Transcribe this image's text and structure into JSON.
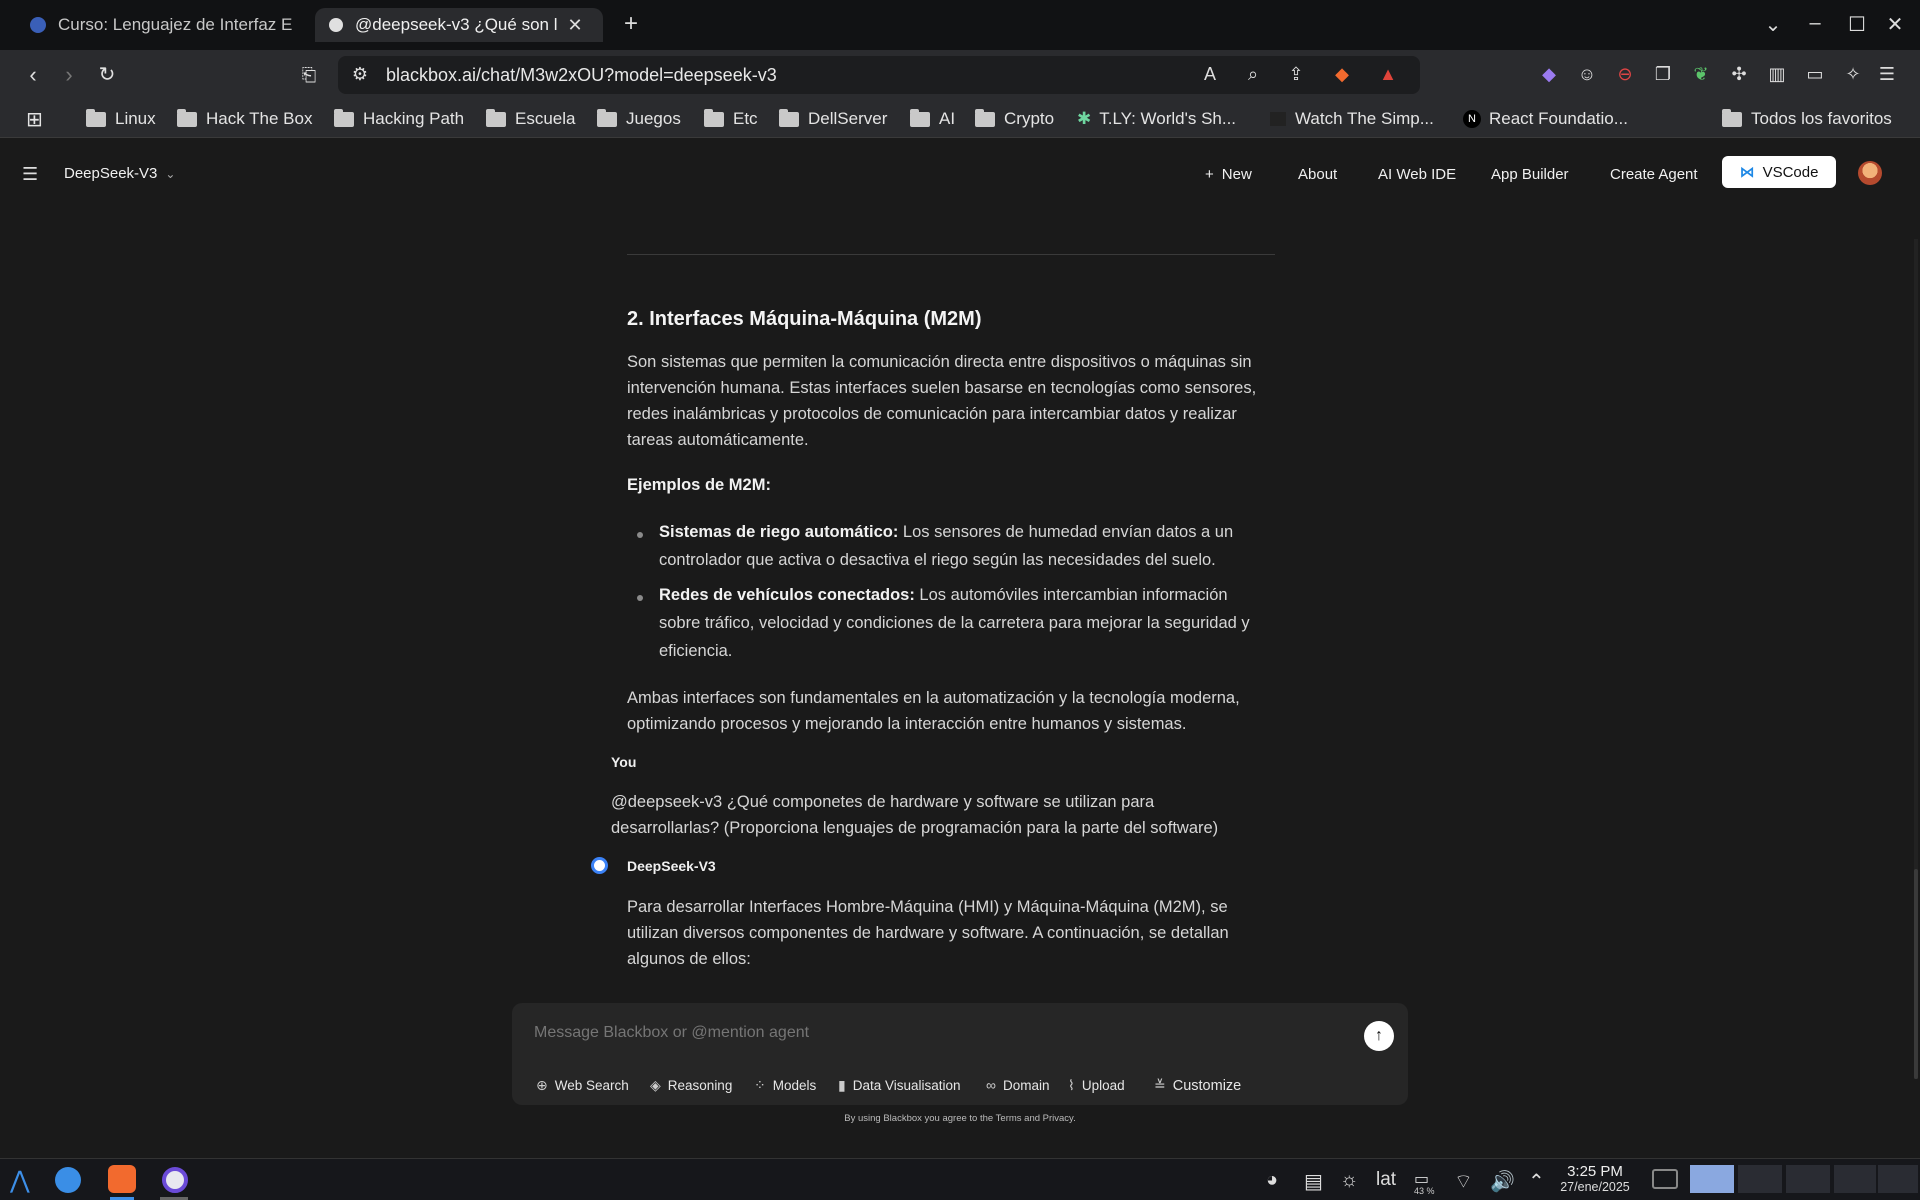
{
  "tabs": [
    {
      "title": "Curso: Lenguajez de Interfaz E"
    },
    {
      "title": "@deepseek-v3 ¿Qué son l"
    }
  ],
  "address_bar": {
    "url": "blackbox.ai/chat/M3w2xOU?model=deepseek-v3"
  },
  "bookmarks": [
    {
      "label": "Linux"
    },
    {
      "label": "Hack The Box"
    },
    {
      "label": "Hacking Path"
    },
    {
      "label": "Escuela"
    },
    {
      "label": "Juegos"
    },
    {
      "label": "Etc"
    },
    {
      "label": "DellServer"
    },
    {
      "label": "AI"
    },
    {
      "label": "Crypto"
    },
    {
      "label": "T.LY: World's Sh..."
    },
    {
      "label": "Watch The Simp..."
    },
    {
      "label": "React Foundatio..."
    },
    {
      "label": "Todos los favoritos"
    }
  ],
  "app_header": {
    "model_selector": "DeepSeek-V3",
    "new_label": "New",
    "about": "About",
    "ai_web_ide": "AI Web IDE",
    "app_builder": "App Builder",
    "create_agent": "Create Agent",
    "vscode": "VSCode"
  },
  "message": {
    "heading": "2. Interfaces Máquina-Máquina (M2M)",
    "intro_line1": "Son sistemas que permiten la comunicación directa entre dispositivos o máquinas sin",
    "intro_line2": "intervención humana. Estas interfaces suelen basarse en tecnologías como sensores,",
    "intro_line3": "redes inalámbricas y protocolos de comunicación para intercambiar datos y realizar",
    "intro_line4": "tareas automáticamente.",
    "examples_title": "Ejemplos de M2M:",
    "bullet1_bold": "Sistemas de riego automático:",
    "bullet1_line1": " Los sensores de humedad envían datos a un",
    "bullet1_line2": "controlador que activa o desactiva el riego según las necesidades del suelo.",
    "bullet2_bold": "Redes de vehículos conectados:",
    "bullet2_line1": " Los automóviles intercambian información",
    "bullet2_line2": "sobre tráfico, velocidad y condiciones de la carretera para mejorar la seguridad y",
    "bullet2_line3": "eficiencia.",
    "conclusion_line1": "Ambas interfaces son fundamentales en la automatización y la tecnología moderna,",
    "conclusion_line2": "optimizando procesos y mejorando la interacción entre humanos y sistemas."
  },
  "user_message": {
    "author": "You",
    "line1": "@deepseek-v3 ¿Qué componetes de hardware y software se utilizan para",
    "line2": "desarrollarlas? (Proporciona lenguajes de programación para la parte del software)"
  },
  "reply": {
    "author": "DeepSeek-V3",
    "line1": "Para desarrollar Interfaces Hombre-Máquina (HMI) y Máquina-Máquina (M2M), se",
    "line2": "utilizan diversos componentes de hardware y software. A continuación, se detallan",
    "line3": "algunos de ellos:"
  },
  "composer": {
    "placeholder": "Message Blackbox or @mention agent",
    "tools": [
      "Web Search",
      "Reasoning",
      "Models",
      "Data Visualisation",
      "Domain",
      "Upload",
      "Customize"
    ],
    "disclaimer": "By using Blackbox you agree to the Terms and Privacy."
  },
  "taskbar": {
    "keyboard_layout": "lat",
    "battery": "43 %",
    "time": "3:25 PM",
    "date": "27/ene/2025"
  },
  "colors": {
    "background": "#1a1a1a",
    "toolbar": "#2a2b2e",
    "tab_strip": "#111214",
    "accent_logo": "#3b82f6"
  }
}
